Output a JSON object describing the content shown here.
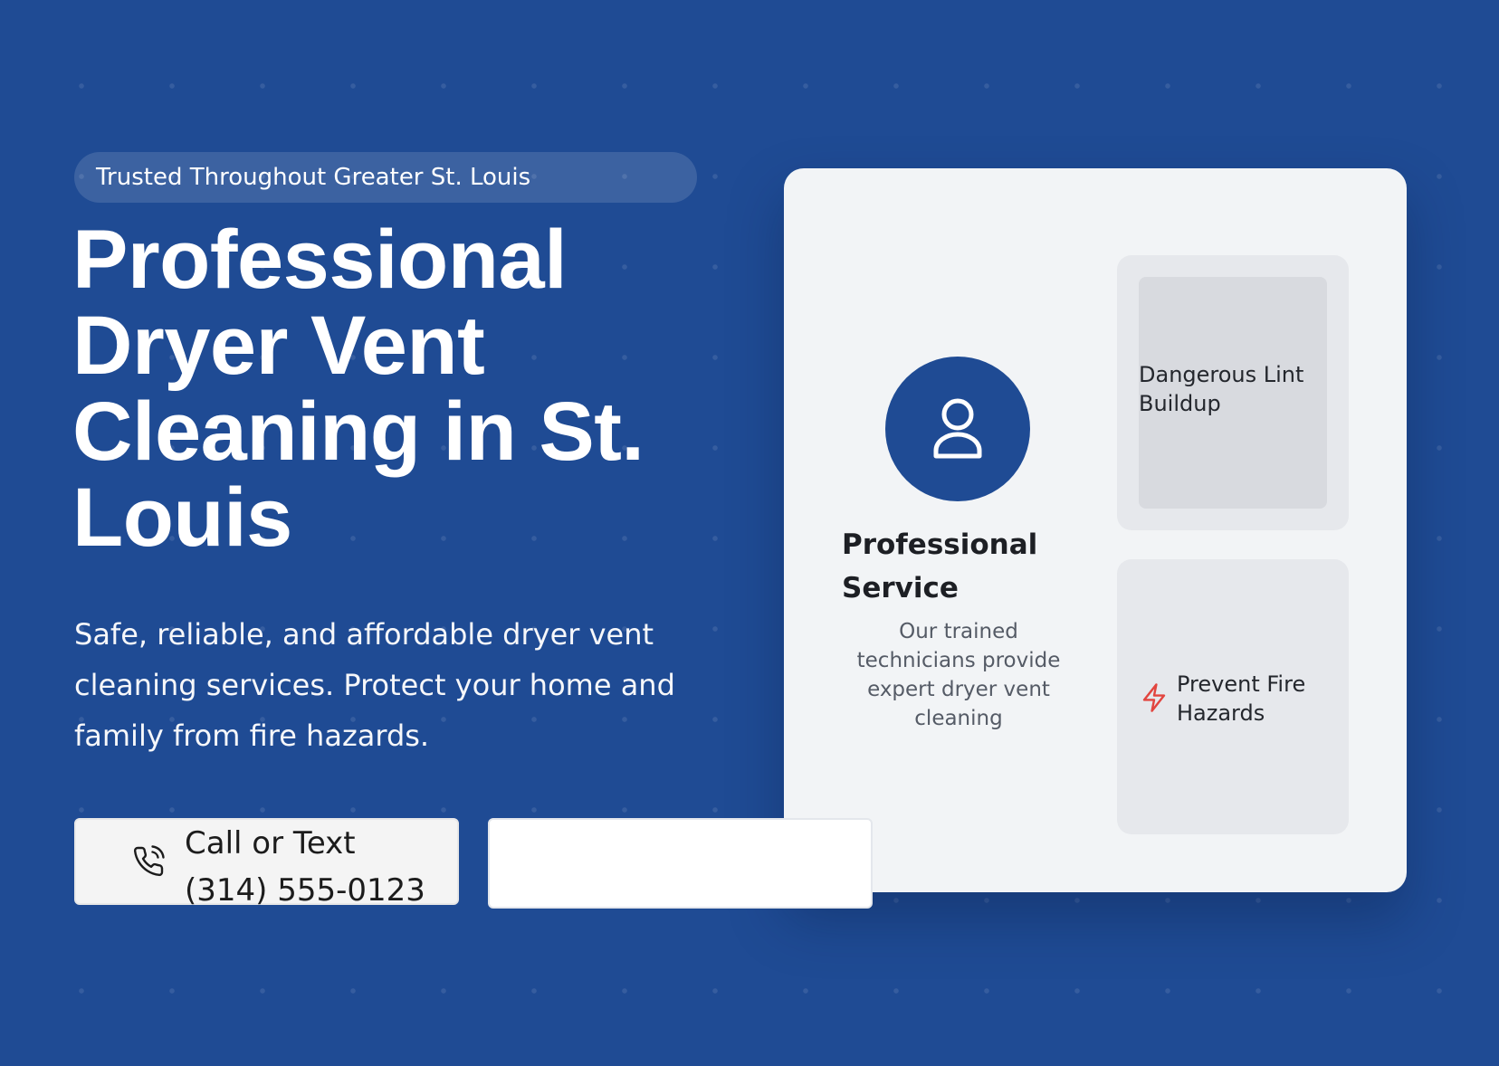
{
  "hero": {
    "badge": "Trusted Throughout Greater St. Louis",
    "title": "Professional Dryer Vent Cleaning in St. Louis",
    "description": "Safe, reliable, and affordable dryer vent cleaning services. Protect your home and family from fire hazards."
  },
  "cta": {
    "call_label": "Call or Text",
    "phone": "(314) 555-0123",
    "secondary_label": ""
  },
  "card": {
    "service_title": "Professional Service",
    "service_desc": "Our trained technicians provide expert dryer vent cleaning",
    "panel_top_label": "Dangerous Lint Buildup",
    "panel_bottom_label": "Prevent Fire Hazards"
  },
  "icons": {
    "phone": "phone-icon",
    "user": "user-icon",
    "bolt": "lightning-bolt-icon"
  },
  "colors": {
    "background": "#1f4b94",
    "accent": "#1f4b94",
    "card": "#f2f4f6",
    "bolt": "#e2453f"
  }
}
